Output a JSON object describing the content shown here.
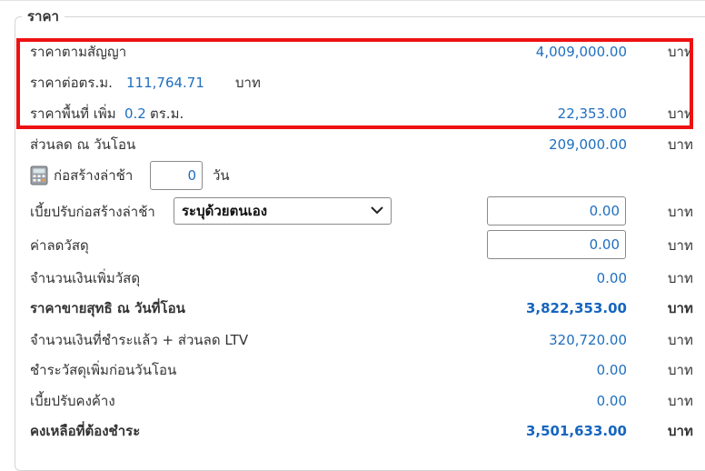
{
  "section": {
    "legend": "ราคา"
  },
  "rows": {
    "contract_price": {
      "label": "ราคาตามสัญญา",
      "value": "4,009,000.00",
      "unit": "บาท"
    },
    "price_per_sqm": {
      "label": "ราคาต่อตร.ม.",
      "value": "111,764.71",
      "unit": "บาท"
    },
    "extra_area_price": {
      "label_prefix": "ราคาพื้นที่ เพิ่ม",
      "area": "0.2",
      "area_unit": "ตร.ม.",
      "value": "22,353.00",
      "unit": "บาท"
    },
    "transfer_discount": {
      "label": "ส่วนลด ณ วันโอน",
      "value": "209,000.00",
      "unit": "บาท"
    },
    "construction_delay": {
      "label": "ก่อสร้างล่าช้า",
      "days_value": "0",
      "days_unit": "วัน"
    },
    "delay_penalty": {
      "label": "เบี้ยปรับก่อสร้างล่าช้า",
      "select_value": "ระบุด้วยตนเอง",
      "input_value": "0.00",
      "unit": "บาท"
    },
    "material_discount": {
      "label": "ค่าลดวัสดุ",
      "input_value": "0.00",
      "unit": "บาท"
    },
    "extra_material_amount": {
      "label": "จำนวนเงินเพิ่มวัสดุ",
      "value": "0.00",
      "unit": "บาท"
    },
    "net_sale_price": {
      "label": "ราคาขายสุทธิ ณ วันที่โอน",
      "value": "3,822,353.00",
      "unit": "บาท"
    },
    "paid_plus_ltv": {
      "label": "จำนวนเงินที่ชำระแล้ว + ส่วนลด LTV",
      "value": "320,720.00",
      "unit": "บาท"
    },
    "extra_material_before_transfer": {
      "label": "ชำระวัสดุเพิ่มก่อนวันโอน",
      "value": "0.00",
      "unit": "บาท"
    },
    "outstanding_penalty": {
      "label": "เบี้ยปรับคงค้าง",
      "value": "0.00",
      "unit": "บาท"
    },
    "remaining_due": {
      "label": "คงเหลือที่ต้องชำระ",
      "value": "3,501,633.00",
      "unit": "บาท"
    }
  },
  "icons": {
    "calculator": "calculator-icon",
    "dropdown": "chevron-down-icon"
  },
  "colors": {
    "highlight": "#ee1111",
    "value_blue": "#1f6fbf"
  }
}
